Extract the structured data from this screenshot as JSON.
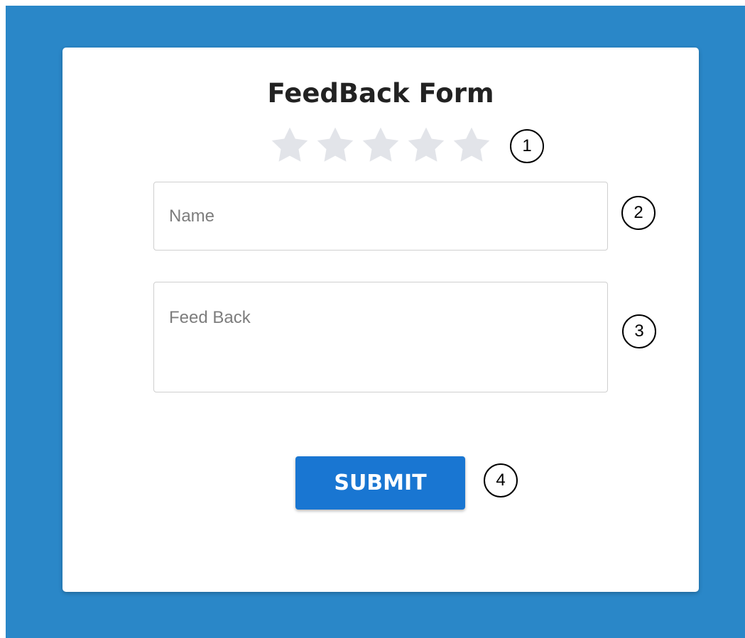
{
  "form": {
    "title": "FeedBack Form",
    "rating": {
      "max": 5,
      "selected": 0
    },
    "name_placeholder": "Name",
    "name_value": "",
    "feedback_placeholder": "Feed Back",
    "feedback_value": "",
    "submit_label": "SUBMIT"
  },
  "annotations": [
    "1",
    "2",
    "3",
    "4"
  ],
  "colors": {
    "background": "#2a87c8",
    "card": "#ffffff",
    "star_empty": "#e2e4e9",
    "button": "#1976d2",
    "button_text": "#ffffff"
  },
  "icons": {
    "star": "star-icon"
  }
}
